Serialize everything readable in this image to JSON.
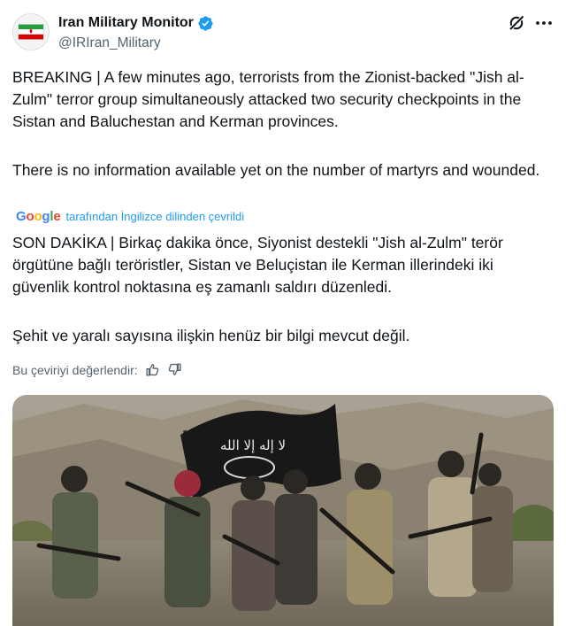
{
  "author": {
    "display_name": "Iran Military Monitor",
    "handle": "@IRIran_Military",
    "verified": true,
    "avatar": "iran-flag-avatar"
  },
  "header_icons": {
    "grok": "grok-icon",
    "more": "more-options-icon"
  },
  "post": {
    "original_paragraphs": [
      "BREAKING | A few minutes ago, terrorists from the Zionist-backed \"Jish al-Zulm\" terror group simultaneously attacked two security checkpoints in the Sistan and Baluchestan and Kerman provinces.",
      "There is no information available yet on the number of martyrs and wounded."
    ],
    "translated_paragraphs": [
      "SON DAKİKA | Birkaç dakika önce, Siyonist destekli \"Jish al-Zulm\" terör örgütüne bağlı teröristler, Sistan ve Beluçistan ile Kerman illerindeki iki güvenlik kontrol noktasına eş zamanlı saldırı düzenledi.",
      "Şehit ve yaralı sayısına ilişkin henüz bir bilgi mevcut değil."
    ]
  },
  "translation": {
    "google_letters": [
      "G",
      "o",
      "o",
      "g",
      "l",
      "e"
    ],
    "google_colors": [
      "#4285f4",
      "#ea4335",
      "#fbbc05",
      "#4285f4",
      "#34a853",
      "#ea4335"
    ],
    "translated_by": "tarafından İngilizce dilinden çevrildi",
    "rate_label": "Bu çeviriyi değerlendir:"
  },
  "media": {
    "type": "photo",
    "description_icon": "militants-photo",
    "flag_text": "لا إله إلا الله"
  },
  "colors": {
    "accent": "#1d9bf0",
    "secondary_text": "#536471",
    "primary_text": "#0f1419"
  }
}
